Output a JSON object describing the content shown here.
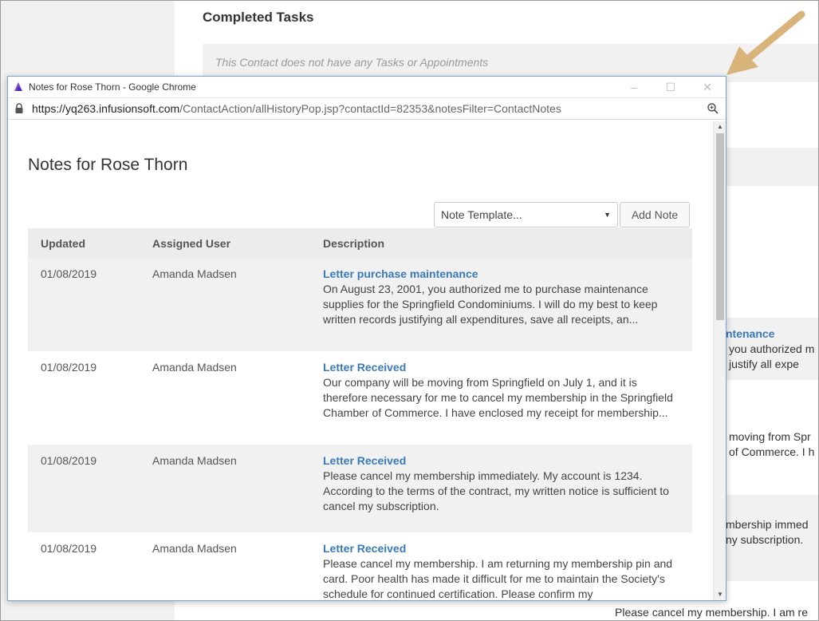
{
  "background": {
    "section_title": "Completed Tasks",
    "empty_message": "This Contact does not have any Tasks or Appointments",
    "fragments": [
      {
        "text": "ntenance",
        "link": true
      },
      {
        "text": "you authorized m",
        "link": false
      },
      {
        "text": "justify all expe",
        "link": false
      },
      {
        "text": "moving from Spr",
        "link": false
      },
      {
        "text": "of Commerce. I h",
        "link": false
      },
      {
        "text": "mbership immed",
        "link": false
      },
      {
        "text": "ny subscription.",
        "link": false
      }
    ],
    "bottom_text": "Please cancel my membership. I am re"
  },
  "popup": {
    "window_title": "Notes for Rose Thorn - Google Chrome",
    "url_host": "https://yq263.infusionsoft.com",
    "url_path": "/ContactAction/allHistoryPop.jsp?contactId=82353&notesFilter=ContactNotes",
    "minimize": "–",
    "maximize": "☐",
    "close": "✕",
    "page_title": "Notes for Rose Thorn",
    "template_select": {
      "value": "Note Template..."
    },
    "add_note_label": "Add Note",
    "table": {
      "headers": [
        "Updated",
        "Assigned User",
        "Description"
      ],
      "rows": [
        {
          "updated": "01/08/2019",
          "user": "Amanda Madsen",
          "title": "Letter purchase maintenance",
          "description": "On August 23, 2001, you authorized me to purchase maintenance supplies for the Springfield Condominiums. I will do my best to keep written records justifying all expenditures, save all receipts, an..."
        },
        {
          "updated": "01/08/2019",
          "user": "Amanda Madsen",
          "title": "Letter Received",
          "description": "Our company will be moving from Springfield on July 1, and it is therefore necessary for me to cancel my membership in the Springfield Chamber of Commerce. I have enclosed my receipt for membership..."
        },
        {
          "updated": "01/08/2019",
          "user": "Amanda Madsen",
          "title": "Letter Received",
          "description": "Please cancel my membership immediately. My account is 1234. According to the terms of the contract, my written notice is sufficient to cancel my subscription."
        },
        {
          "updated": "01/08/2019",
          "user": "Amanda Madsen",
          "title": "Letter Received",
          "description": "Please cancel my membership. I am returning my membership pin and card. Poor health has made it difficult for me to maintain the Society's schedule for continued certification. Please confirm my"
        }
      ]
    }
  },
  "colors": {
    "accent_link": "#3a7ab8",
    "arrow": "#d9b47a",
    "window_border": "#7aa3d0"
  }
}
